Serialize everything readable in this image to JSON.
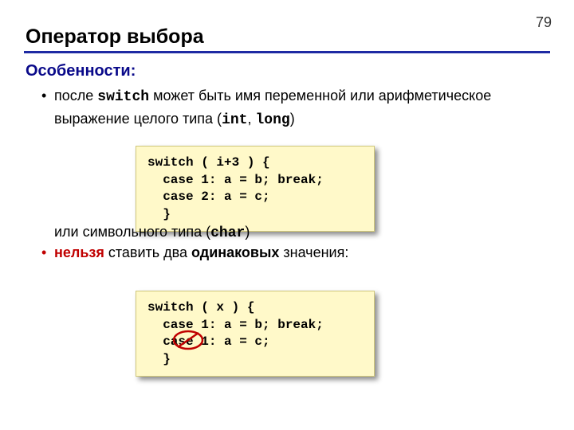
{
  "page_number": "79",
  "title": "Оператор выбора",
  "subhead": "Особенности:",
  "bullet1_prefix": "после ",
  "kw_switch": "switch",
  "bullet1_mid": " может быть имя переменной или арифметическое выражение целого типа (",
  "kw_int": "int",
  "comma": ", ",
  "kw_long": "long",
  "paren_close": ")",
  "code1": "switch ( i+3 ) {\n  case 1: a = b; break;\n  case 2: a = c;\n  }",
  "line2_prefix": "или символьного типа (",
  "kw_char": "char",
  "bullet2_word1": "нельзя",
  "bullet2_mid": " ставить два ",
  "bullet2_word2": "одинаковых",
  "bullet2_end": " значения:",
  "code2": "switch ( x ) {\n  case 1: a = b; break;\n  case 1: a = c;\n  }"
}
